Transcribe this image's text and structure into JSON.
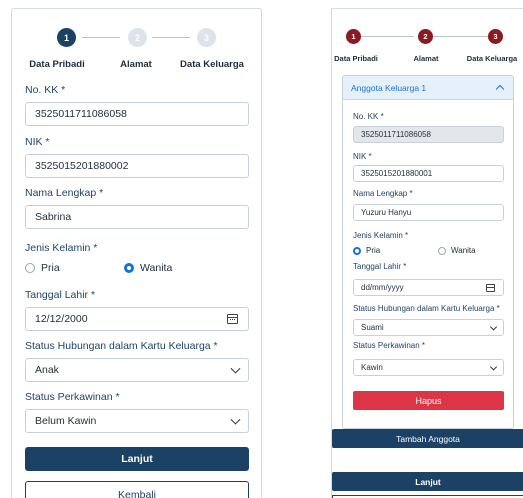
{
  "left_form": {
    "steps": [
      {
        "number": "1",
        "label": "Data Pribadi"
      },
      {
        "number": "2",
        "label": "Alamat"
      },
      {
        "number": "3",
        "label": "Data Keluarga"
      }
    ],
    "no_kk": {
      "label": "No. KK *",
      "value": "3525011711086058"
    },
    "nik": {
      "label": "NIK *",
      "value": "3525015201880002"
    },
    "nama": {
      "label": "Nama Lengkap *",
      "value": "Sabrina"
    },
    "jenis_kelamin": {
      "label": "Jenis Kelamin *",
      "options": [
        "Pria",
        "Wanita"
      ],
      "selected": "Wanita"
    },
    "tanggal_lahir": {
      "label": "Tanggal Lahir *",
      "value": "12/12/2000"
    },
    "status_hubungan": {
      "label": "Status Hubungan dalam Kartu Keluarga *",
      "value": "Anak"
    },
    "status_perkawinan": {
      "label": "Status Perkawinan *",
      "value": "Belum Kawin"
    },
    "next_button": "Lanjut",
    "back_button": "Kembali"
  },
  "right_form": {
    "steps": [
      {
        "number": "1",
        "label": "Data Pribadi"
      },
      {
        "number": "2",
        "label": "Alamat"
      },
      {
        "number": "3",
        "label": "Data Keluarga"
      }
    ],
    "accordion_title": "Anggota Keluarga 1",
    "no_kk": {
      "label": "No. KK *",
      "value": "3525011711086058"
    },
    "nik": {
      "label": "NIK *",
      "value": "3525015201880001"
    },
    "nama": {
      "label": "Nama Lengkap *",
      "value": "Yuzuru Hanyu"
    },
    "jenis_kelamin": {
      "label": "Jenis Kelamin *",
      "options": [
        "Pria",
        "Wanita"
      ],
      "selected": "Pria"
    },
    "tanggal_lahir": {
      "label": "Tanggal Lahir *",
      "placeholder": "dd/mm/yyyy"
    },
    "status_hubungan": {
      "label": "Status Hubungan dalam Kartu Keluarga *",
      "value": "Suami"
    },
    "status_perkawinan": {
      "label": "Status Perkawinan *",
      "value": "Kawin"
    },
    "delete_button": "Hapus",
    "add_member_button": "Tambah Anggota",
    "next_button": "Lanjut"
  },
  "colors": {
    "primary": "#1b4164",
    "step_done": "#8b1a22",
    "step_idle": "#dde3ea",
    "accent": "#1672d8",
    "danger": "#dc3545"
  }
}
